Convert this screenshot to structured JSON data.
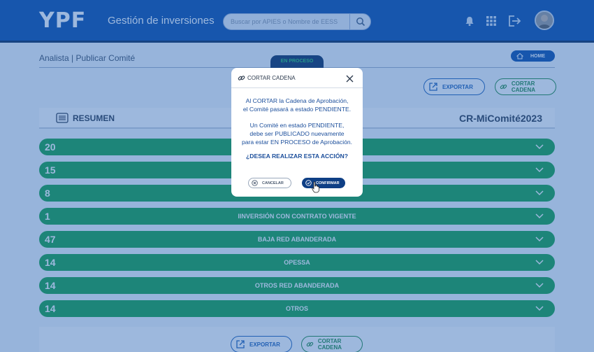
{
  "header": {
    "logo": "YPF",
    "title": "Gestión de inversiones",
    "search_placeholder": "Buscar por APIES o Nombre de EESS"
  },
  "page": {
    "breadcrumb": "Analista | Publicar Comité",
    "status_tab": "EN PROCESO",
    "home_label": "HOME",
    "export_label": "EXPORTAR",
    "cut_chain_label": "CORTAR CADENA"
  },
  "summary": {
    "label": "RESUMEN",
    "code": "CR-MiComité2023"
  },
  "rows": [
    {
      "count": "20",
      "label": ""
    },
    {
      "count": "15",
      "label": ""
    },
    {
      "count": "8",
      "label": ""
    },
    {
      "count": "1",
      "label": "IINVERSIÓN CON CONTRATO VIGENTE"
    },
    {
      "count": "47",
      "label": "BAJA RED ABANDERADA"
    },
    {
      "count": "14",
      "label": "OPESSA"
    },
    {
      "count": "14",
      "label": "OTROS RED ABANDERADA"
    },
    {
      "count": "14",
      "label": "OTROS"
    }
  ],
  "footer": {
    "export_label": "EXPORTAR",
    "cut_chain_label": "CORTAR CADENA"
  },
  "modal": {
    "title": "CORTAR CADENA",
    "line1": "Al CORTAR la Cadena de Aprobación,",
    "line2": "el Comité pasará a estado PENDIENTE.",
    "line3": "Un Comité en estado PENDIENTE,",
    "line4": "debe ser PUBLICADO nuevamente",
    "line5": "para estar EN PROCESO de Aprobación.",
    "question": "¿DESEA REALIZAR ESTA ACCIÓN?",
    "cancel_label": "CANCELAR",
    "confirm_label": "CONFIRMAR"
  },
  "colors": {
    "header_blue": "#0b4ea8",
    "row_green": "#17a34a",
    "modal_text_blue": "#1b4e9b",
    "confirm_navy": "#0e3f85"
  },
  "icons": [
    "search-icon",
    "bell-icon",
    "apps-grid-icon",
    "logout-icon",
    "home-icon",
    "export-icon",
    "link-icon",
    "list-icon",
    "chevron-down-icon",
    "close-icon",
    "cancel-icon",
    "check-icon",
    "cursor-hand-icon"
  ]
}
